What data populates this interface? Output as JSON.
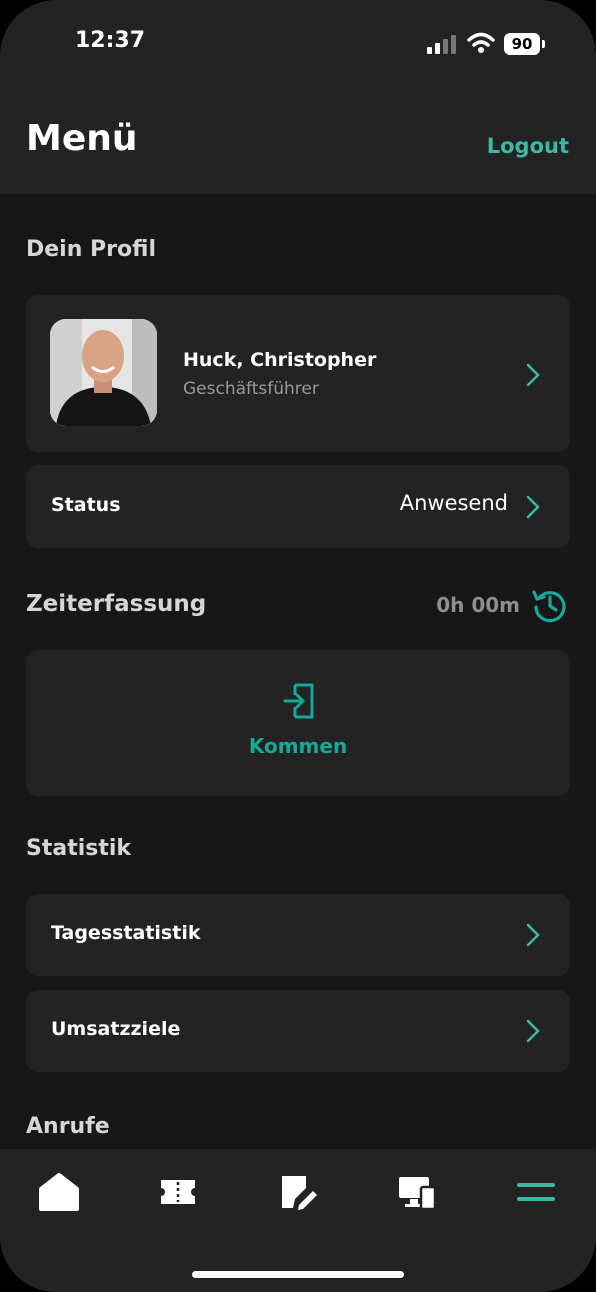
{
  "status_bar": {
    "time": "12:37",
    "battery": "90"
  },
  "header": {
    "title": "Menü",
    "logout_label": "Logout"
  },
  "profile_section": {
    "heading": "Dein Profil",
    "name": "Huck, Christopher",
    "role": "Geschäftsführer",
    "status_label": "Status",
    "status_value": "Anwesend"
  },
  "time_tracking": {
    "heading": "Zeiterfassung",
    "total": "0h 00m",
    "action_label": "Kommen"
  },
  "statistics": {
    "heading": "Statistik",
    "items": [
      {
        "label": "Tagesstatistik"
      },
      {
        "label": "Umsatzziele"
      }
    ]
  },
  "calls": {
    "heading": "Anrufe"
  },
  "tab_bar": {
    "tabs": [
      {
        "icon": "home-icon"
      },
      {
        "icon": "ticket-icon"
      },
      {
        "icon": "edit-note-icon"
      },
      {
        "icon": "devices-icon"
      },
      {
        "icon": "menu-icon",
        "active": true
      }
    ]
  },
  "colors": {
    "accent": "#3db8a5",
    "background": "#171717",
    "card": "#232323"
  }
}
